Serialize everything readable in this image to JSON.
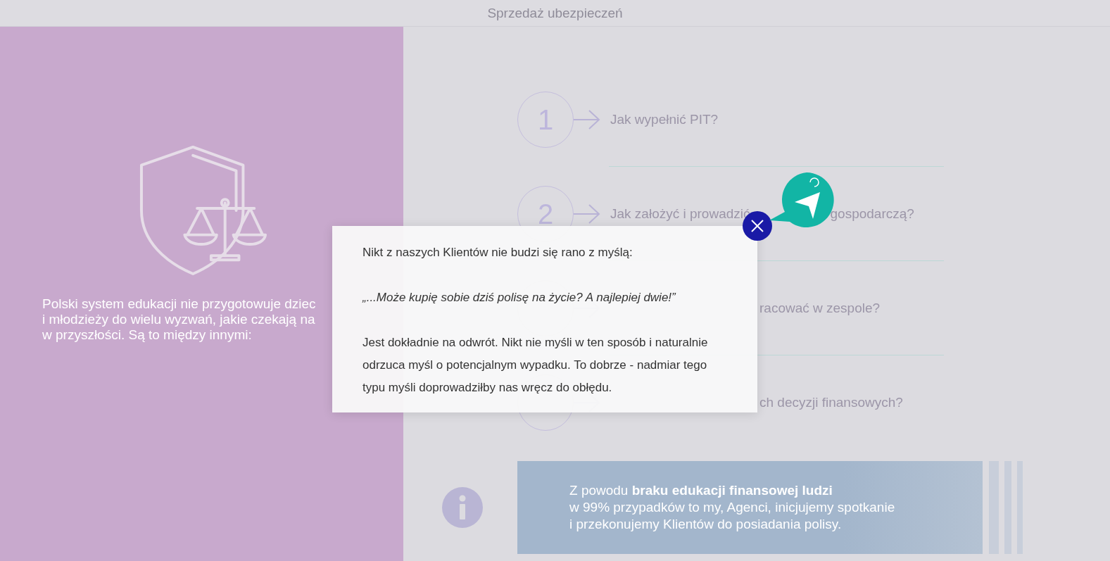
{
  "header": {
    "title": "Sprzedaż ubezpieczeń"
  },
  "intro": {
    "lines": [
      "Polski system edukacji nie przygotowuje dziec",
      "i młodzieży do wielu wyzwań, jakie czekają na",
      "w przyszłości. Są to między innymi:"
    ]
  },
  "steps": [
    {
      "number": "1",
      "parts": [
        "Jak wypełnić PIT?"
      ]
    },
    {
      "number": "2",
      "parts": [
        "Jak założyć i prowadzić",
        "gospodarczą?"
      ]
    },
    {
      "parts": [
        "racować w zespole?"
      ]
    },
    {
      "parts": [
        "ch decyzji finansowych?"
      ]
    }
  ],
  "info": {
    "lines": [
      "Z powodu **braku edukacji finansowej ludzi**",
      "w 99% przypadków to my, Agenci, inicjujemy spotkanie",
      "i przekonujemy Klientów do posiadania polisy."
    ]
  },
  "modal": {
    "paragraphs": [
      {
        "kind": "plain",
        "text": "Nikt z naszych Klientów nie budzi się rano z myślą:"
      },
      {
        "kind": "quote",
        "text": "„...Może kupię sobie dziś polisę na życie? A najlepiej dwie!”"
      },
      {
        "kind": "plain",
        "text": "Jest dokładnie na odwrót. Nikt nie myśli w ten sposób i naturalnie odrzuca myśl o potencjalnym wypadku. To dobrze - nadmiar tego typu myśli doprowadziłby nas wręcz do obłędu."
      }
    ]
  }
}
